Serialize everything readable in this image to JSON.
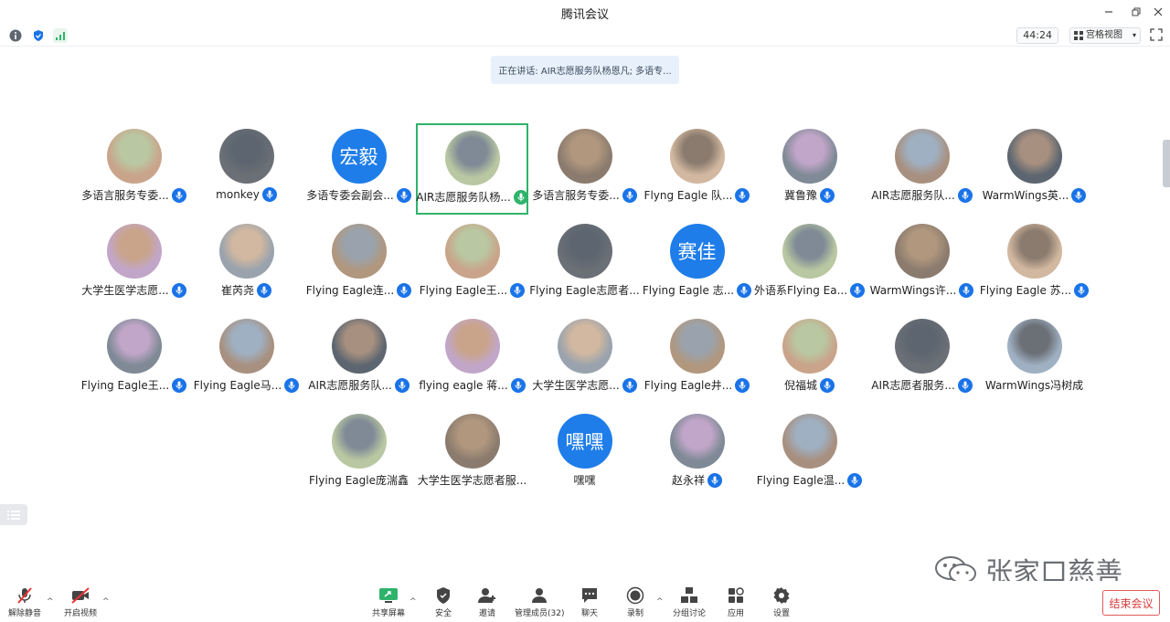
{
  "window": {
    "title": "腾讯会议"
  },
  "infobar": {
    "timer": "44:24",
    "view_label": "宫格视图"
  },
  "speaker_banner": "正在讲话: AIR志愿服务队杨恩凡; 多语专...",
  "participants": [
    {
      "name": "多语言服务专委...",
      "avatar": "tiger-cartoon",
      "mic": "blue"
    },
    {
      "name": "monkey",
      "avatar": "man-suit-photo",
      "mic": "blue"
    },
    {
      "name": "多语专委会副会...",
      "avatar_text": "宏毅",
      "mic": "blue"
    },
    {
      "name": "AIR志愿服务队杨...",
      "avatar": "girl-white-dress-photo",
      "mic": "green"
    },
    {
      "name": "多语言服务专委...",
      "avatar": "girl-photo",
      "mic": "blue"
    },
    {
      "name": "Flyng Eagle 队...",
      "avatar": "girl-green-photo",
      "mic": "blue"
    },
    {
      "name": "冀鲁豫",
      "avatar": "cat-burger-cartoon",
      "mic": "blue"
    },
    {
      "name": "AIR志愿服务队...",
      "avatar": "night-person-photo",
      "mic": "blue"
    },
    {
      "name": "WarmWings英...",
      "avatar": "anime-boy",
      "mic": "blue"
    },
    {
      "name": "大学生医学志愿...",
      "avatar": "girl-photo",
      "mic": "blue"
    },
    {
      "name": "崔芮尧",
      "avatar": "girl-dark-photo",
      "mic": "blue"
    },
    {
      "name": "Flying Eagle连...",
      "avatar": "girl-phone-photo",
      "mic": "blue"
    },
    {
      "name": "Flying Eagle王...",
      "avatar": "sign-photo",
      "mic": "blue"
    },
    {
      "name": "Flying Eagle志愿者...",
      "avatar": "purple-creature",
      "mic": null
    },
    {
      "name": "Flying Eagle 志...",
      "avatar_text": "赛佳",
      "mic": "blue"
    },
    {
      "name": "外语系Flying Ea...",
      "avatar": "cartoon-girl",
      "mic": "blue"
    },
    {
      "name": "WarmWings许...",
      "avatar": "dog-photo",
      "mic": "blue"
    },
    {
      "name": "Flying Eagle 苏...",
      "avatar": "white-rabbit",
      "mic": "blue"
    },
    {
      "name": "Flying Eagle王...",
      "avatar": "dark-girl-photo",
      "mic": "blue"
    },
    {
      "name": "Flying Eagle马...",
      "avatar": "anime-dark-boy",
      "mic": "blue"
    },
    {
      "name": "AIR志愿服务队...",
      "avatar": "snow-girl-photo",
      "mic": "blue"
    },
    {
      "name": "flying eagle 蒋...",
      "avatar": "night-figure",
      "mic": "blue"
    },
    {
      "name": "大学生医学志愿...",
      "avatar": "cat-photo",
      "mic": "blue"
    },
    {
      "name": "Flying Eagle井...",
      "avatar": "curly-girl-photo",
      "mic": "blue"
    },
    {
      "name": "倪福城",
      "avatar": "sky-photo",
      "mic": "blue"
    },
    {
      "name": "AIR志愿者服务...",
      "avatar": "man-face-photo",
      "mic": "blue"
    },
    {
      "name": "WarmWings冯树成",
      "avatar": "dark-portrait",
      "mic": null
    },
    {
      "name": "Flying Eagle庞湍鑫",
      "avatar": "girl-portrait",
      "mic": null
    },
    {
      "name": "大学生医学志愿者服...",
      "avatar": "black-bear-logo",
      "mic": null
    },
    {
      "name": "嘿嘿",
      "avatar_text": "嘿嘿",
      "mic": null
    },
    {
      "name": "赵永祥",
      "avatar": "anime-red-boy",
      "mic": "blue"
    },
    {
      "name": "Flying Eagle温...",
      "avatar": "room-photo",
      "mic": "blue"
    }
  ],
  "toolbar": {
    "unmute": "解除静音",
    "start_video": "开启视频",
    "share_screen": "共享屏幕",
    "security": "安全",
    "invite": "邀请",
    "manage": "管理成员(32)",
    "chat": "聊天",
    "record": "录制",
    "breakout": "分组讨论",
    "apps": "应用",
    "settings": "设置",
    "end_meeting": "结束会议"
  },
  "watermark": {
    "text": "张家口慈善"
  },
  "colors": {
    "accent": "#1a73e8",
    "speaking": "#2fb36b",
    "end": "#d83b3b"
  }
}
